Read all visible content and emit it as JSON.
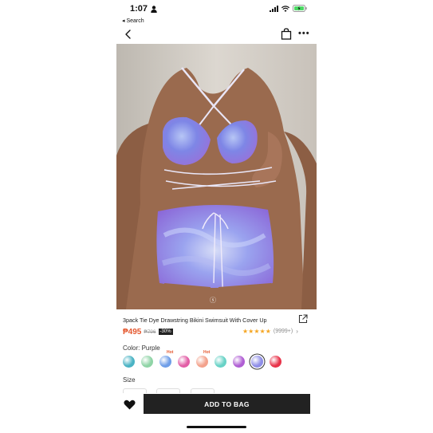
{
  "status_bar": {
    "time": "1:07",
    "back_app_label": "◂ Search"
  },
  "nav": {
    "back_icon": "chevron-left-icon",
    "bag_icon": "shopping-bag-icon",
    "more_label": "•••"
  },
  "product": {
    "image_watermark": "ⓢ",
    "title": "3pack Tie Dye Drawstring Bikini Swimsuit With Cover Up",
    "price": "₱495",
    "original_price": "₱796",
    "discount": "-30%",
    "rating_stars": "★★★★★",
    "rating_value": 4.5,
    "review_count": "(9999+)",
    "rating_chevron": "›"
  },
  "color": {
    "label": "Color: Purple",
    "swatches": [
      {
        "name": "teal",
        "color": "#4ab3c4",
        "hot": ""
      },
      {
        "name": "mint",
        "color": "#8fd4a6",
        "hot": ""
      },
      {
        "name": "blue",
        "color": "#6f9ee8",
        "hot": "Hot"
      },
      {
        "name": "pink",
        "color": "#e25ea6",
        "hot": ""
      },
      {
        "name": "peach",
        "color": "#f3a28c",
        "hot": "Hot"
      },
      {
        "name": "aqua",
        "color": "#68d2c6",
        "hot": ""
      },
      {
        "name": "violet",
        "color": "#b05ed4",
        "hot": ""
      },
      {
        "name": "purple",
        "color": "#8f8ee8",
        "hot": "",
        "selected": true
      },
      {
        "name": "red",
        "color": "#e8334a",
        "hot": ""
      }
    ]
  },
  "size": {
    "label": "Size"
  },
  "actions": {
    "favorite_icon": "heart-icon",
    "add_to_bag": "ADD TO BAG"
  }
}
